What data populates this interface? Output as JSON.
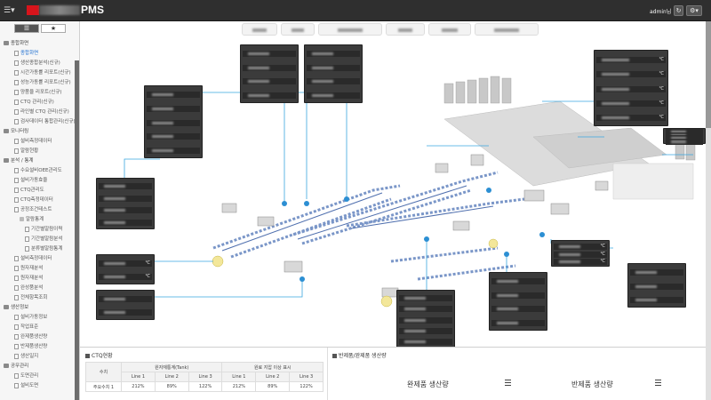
{
  "app": {
    "title": "PMS",
    "user": "admin님"
  },
  "topbar": {
    "menu_icon": "list-icon",
    "refresh_icon": "refresh-icon",
    "settings_icon": "gear-icon"
  },
  "sidebar": {
    "tabs": [
      {
        "label": "☰"
      },
      {
        "label": "★"
      }
    ],
    "tree": [
      {
        "label": "종합화면",
        "level": 0
      },
      {
        "label": "종합화면",
        "level": 1,
        "active": true
      },
      {
        "label": "생산종합분석(신규)",
        "level": 1
      },
      {
        "label": "시간가동률 리포트(신규)",
        "level": 1
      },
      {
        "label": "성능가동률 리포트(신규)",
        "level": 1
      },
      {
        "label": "양품율 리포트(신규)",
        "level": 1
      },
      {
        "label": "CTQ 관리(신규)",
        "level": 1
      },
      {
        "label": "라인별 CTQ 관리(신규)",
        "level": 1
      },
      {
        "label": "검사데이터 통합관리(신규)",
        "level": 1
      },
      {
        "label": "모니터링",
        "level": 0
      },
      {
        "label": "설비측정데이터",
        "level": 1
      },
      {
        "label": "알람현황",
        "level": 1
      },
      {
        "label": "분석 / 통계",
        "level": 0
      },
      {
        "label": "수요설비OEE관리도",
        "level": 1
      },
      {
        "label": "설비가동효율",
        "level": 1
      },
      {
        "label": "CTQ관리도",
        "level": 1
      },
      {
        "label": "CTQ측정데이터",
        "level": 1
      },
      {
        "label": "공정조건테스트",
        "level": 1
      },
      {
        "label": "알람통계",
        "level": 2
      },
      {
        "label": "기간별알람이력",
        "level": 3
      },
      {
        "label": "기간별알람분석",
        "level": 3
      },
      {
        "label": "분류별알람통계",
        "level": 3
      },
      {
        "label": "설비측정데이터",
        "level": 1
      },
      {
        "label": "원자재분석",
        "level": 1
      },
      {
        "label": "원자재분석",
        "level": 1
      },
      {
        "label": "완성품분석",
        "level": 1
      },
      {
        "label": "전체항목조회",
        "level": 1
      },
      {
        "label": "생산정보",
        "level": 0
      },
      {
        "label": "설비가동정보",
        "level": 1
      },
      {
        "label": "작업표준",
        "level": 1
      },
      {
        "label": "완제품생산량",
        "level": 1
      },
      {
        "label": "반제품생산량",
        "level": 1
      },
      {
        "label": "생산일지",
        "level": 1
      },
      {
        "label": "공무관리",
        "level": 0
      },
      {
        "label": "도면관리",
        "level": 1
      },
      {
        "label": "설비도면",
        "level": 1
      }
    ]
  },
  "panels": [
    {
      "rows": 4,
      "unit": ""
    },
    {
      "rows": 4,
      "unit": ""
    },
    {
      "rows": 5,
      "unit": ""
    },
    {
      "rows": 4,
      "unit": ""
    },
    {
      "rows": 5,
      "unit": "℃"
    },
    {
      "rows": 4,
      "unit": ""
    },
    {
      "rows": 2,
      "unit": "℃"
    },
    {
      "rows": 2,
      "unit": ""
    },
    {
      "rows": 5,
      "unit": ""
    },
    {
      "rows": 4,
      "unit": ""
    },
    {
      "rows": 3,
      "unit": "℃"
    },
    {
      "rows": 3,
      "unit": ""
    }
  ],
  "bottom": {
    "ctq": {
      "title": "CTQ현황",
      "col_header": "수치",
      "group1": "원자재통계(Tank)",
      "group2": "원료 지압 이상 표시",
      "lines": [
        "Line 1",
        "Line 2",
        "Line 3",
        "Line 1",
        "Line 2",
        "Line 3"
      ],
      "row_label": "주요수치 1",
      "values": [
        "212%",
        "89%",
        "122%",
        "212%",
        "89%",
        "122%"
      ]
    },
    "production": {
      "title": "반제품/완제품 생산량",
      "finished_label": "완제품 생산량",
      "semi_label": "반제품 생산량"
    }
  }
}
